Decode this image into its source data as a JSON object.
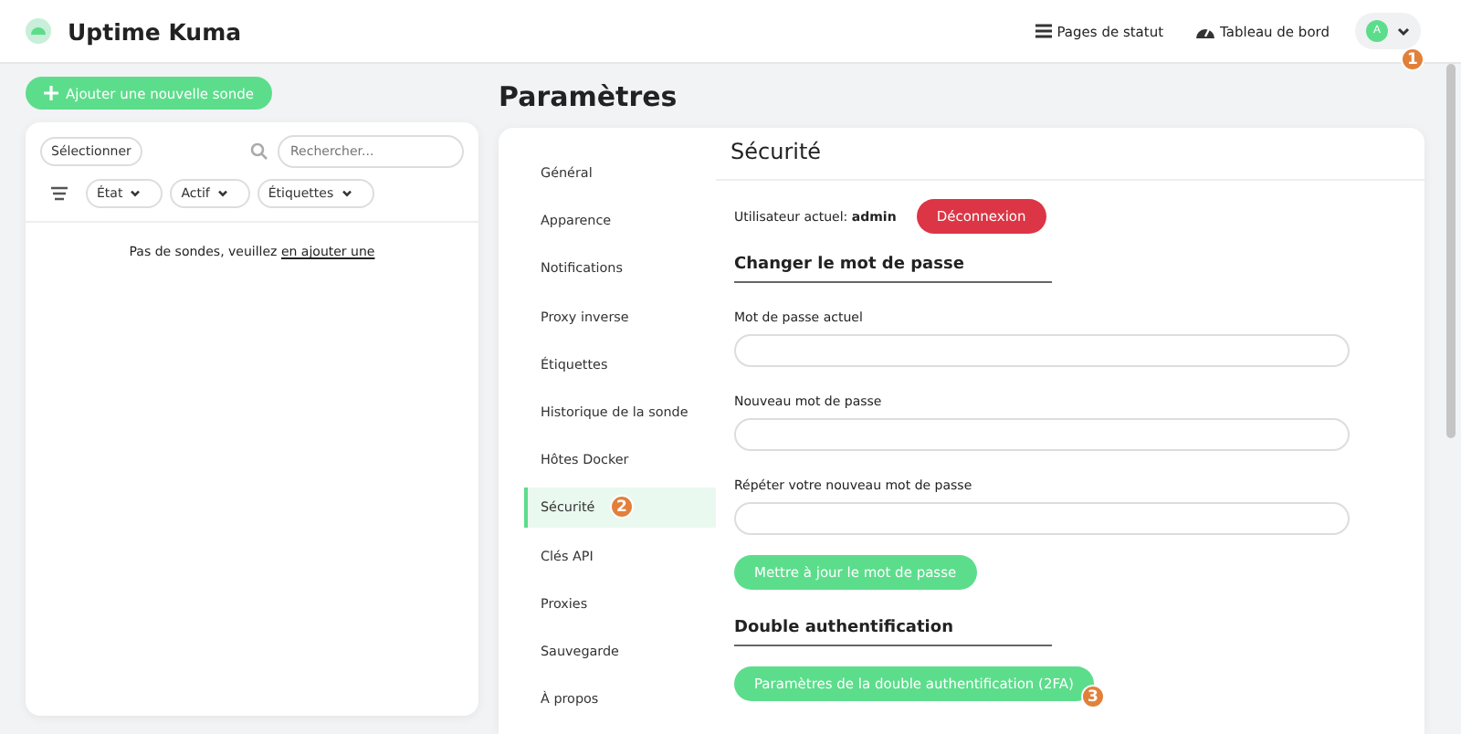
{
  "header": {
    "title": "Uptime Kuma",
    "links": [
      {
        "kind": "list",
        "label": "Pages de statut"
      },
      {
        "kind": "gauge",
        "label": "Tableau de bord"
      }
    ],
    "user_menu": {
      "initial": "A",
      "marker": "1"
    }
  },
  "monitor_list": {
    "add_button": "Ajouter une nouvelle sonde",
    "select_button": "Sélectionner",
    "search": {
      "placeholder": "Rechercher..."
    },
    "filters": [
      "État",
      "Actif",
      "Étiquettes"
    ],
    "empty_text": "Pas de sondes, veuillez ",
    "empty_link": "en ajouter une"
  },
  "page_title": "Paramètres",
  "settings_nav": [
    {
      "label": "Général",
      "selected": false
    },
    {
      "label": "Apparence",
      "selected": false
    },
    {
      "label": "Notifications",
      "selected": false
    },
    {
      "label": "Proxy inverse",
      "selected": false
    },
    {
      "label": "Étiquettes",
      "selected": false
    },
    {
      "label": "Historique de la sonde",
      "selected": false
    },
    {
      "label": "Hôtes Docker",
      "selected": false
    },
    {
      "label": "Sécurité",
      "selected": true,
      "marker": "2"
    },
    {
      "label": "Clés API",
      "selected": false
    },
    {
      "label": "Proxies",
      "selected": false
    },
    {
      "label": "Sauvegarde",
      "selected": false
    },
    {
      "label": "À propos",
      "selected": false
    }
  ],
  "security": {
    "title": "Sécurité",
    "current_user": "Utilisateur actuel: **admin**",
    "logout_button": "Déconnexion",
    "password_section": {
      "heading": "Changer le mot de passe",
      "fields": [
        {
          "label": "Mot de passe actuel"
        },
        {
          "label": "Nouveau mot de passe"
        },
        {
          "label": "Répéter votre nouveau mot de passe"
        }
      ],
      "button": "Mettre à jour le mot de passe"
    },
    "twofa_section": {
      "heading": "Double authentification",
      "button": "Paramètres de la double authentification (2FA)",
      "marker": "3"
    }
  }
}
